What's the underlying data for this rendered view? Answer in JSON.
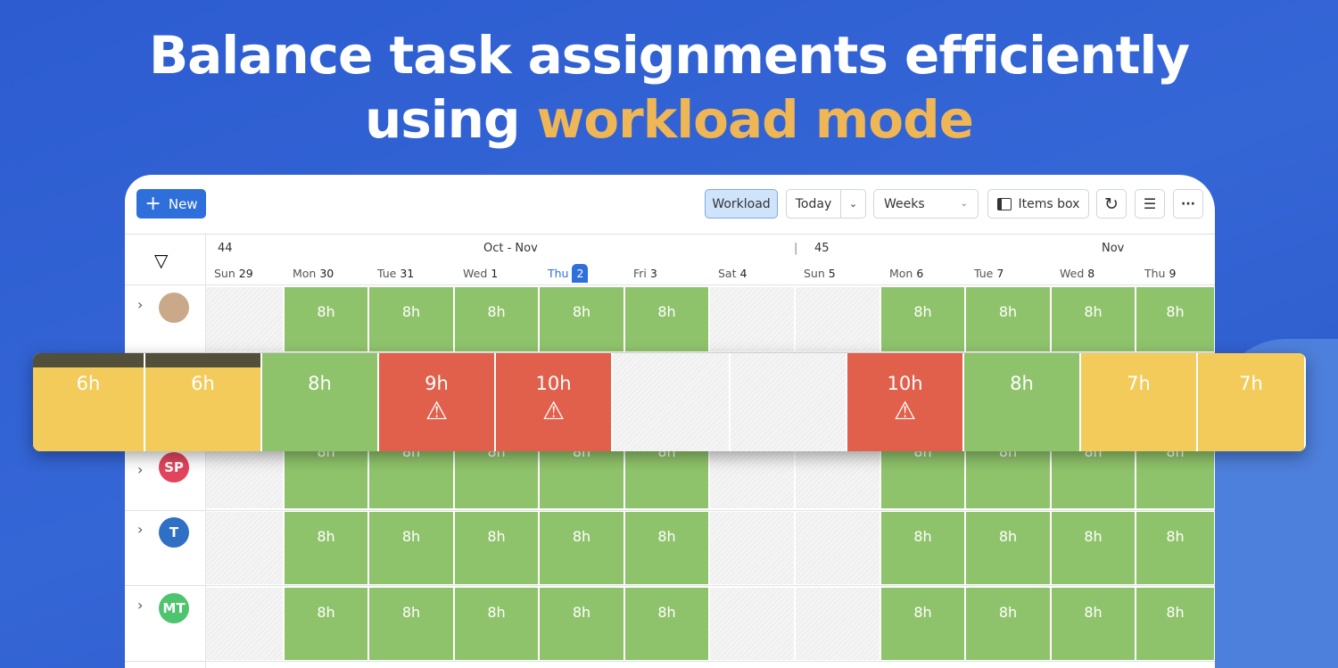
{
  "headline": {
    "line1": "Balance task assignments efficiently",
    "line2_plain": "using ",
    "line2_accent": "workload mode"
  },
  "toolbar": {
    "new_label": "New",
    "workload_label": "Workload",
    "today_label": "Today",
    "weeks_label": "Weeks",
    "items_box_label": "Items box"
  },
  "calendar": {
    "week_a": "44",
    "week_b": "45",
    "month_a": "Oct  -  Nov",
    "month_b": "Nov",
    "days": [
      {
        "dow": "Sun",
        "d": "29"
      },
      {
        "dow": "Mon",
        "d": "30"
      },
      {
        "dow": "Tue",
        "d": "31"
      },
      {
        "dow": "Wed",
        "d": "1"
      },
      {
        "dow": "Thu",
        "d": "2",
        "today": true
      },
      {
        "dow": "Fri",
        "d": "3"
      },
      {
        "dow": "Sat",
        "d": "4"
      },
      {
        "dow": "Sun",
        "d": "5"
      },
      {
        "dow": "Mon",
        "d": "6"
      },
      {
        "dow": "Tue",
        "d": "7"
      },
      {
        "dow": "Wed",
        "d": "8"
      },
      {
        "dow": "Thu",
        "d": "9"
      }
    ]
  },
  "rows": [
    {
      "avatar": "photo",
      "initials": "",
      "color": "#c9a98a",
      "cells": [
        "",
        "8h",
        "8h",
        "8h",
        "8h",
        "8h",
        "",
        "",
        "8h",
        "8h",
        "8h",
        "8h"
      ]
    },
    {
      "avatar": "initials",
      "initials": "SP",
      "color": "#e2445c",
      "cells": [
        "",
        "8h",
        "8h",
        "8h",
        "8h",
        "8h",
        "",
        "",
        "8h",
        "8h",
        "8h",
        "8h"
      ]
    },
    {
      "avatar": "initials",
      "initials": "T",
      "color": "#2f6fc4",
      "cells": [
        "",
        "8h",
        "8h",
        "8h",
        "8h",
        "8h",
        "",
        "",
        "8h",
        "8h",
        "8h",
        "8h"
      ]
    },
    {
      "avatar": "initials",
      "initials": "MT",
      "color": "#4fc46f",
      "cells": [
        "",
        "8h",
        "8h",
        "8h",
        "8h",
        "8h",
        "",
        "",
        "8h",
        "8h",
        "8h",
        "8h"
      ]
    }
  ],
  "highlight_strip": [
    {
      "value": "6h",
      "status": "under",
      "overtime_bar": true
    },
    {
      "value": "6h",
      "status": "under",
      "overtime_bar": true
    },
    {
      "value": "8h",
      "status": "full"
    },
    {
      "value": "9h",
      "status": "over",
      "warning": true
    },
    {
      "value": "10h",
      "status": "over",
      "warning": true
    },
    {
      "value": "",
      "status": "off"
    },
    {
      "value": "",
      "status": "off"
    },
    {
      "value": "10h",
      "status": "over",
      "warning": true
    },
    {
      "value": "8h",
      "status": "full"
    },
    {
      "value": "7h",
      "status": "under"
    },
    {
      "value": "7h",
      "status": "under"
    }
  ],
  "colors": {
    "full": "#8fc36b",
    "under": "#f3cb5b",
    "over": "#e0604b",
    "bar": "#524f3b",
    "primary": "#2e6fdb"
  }
}
